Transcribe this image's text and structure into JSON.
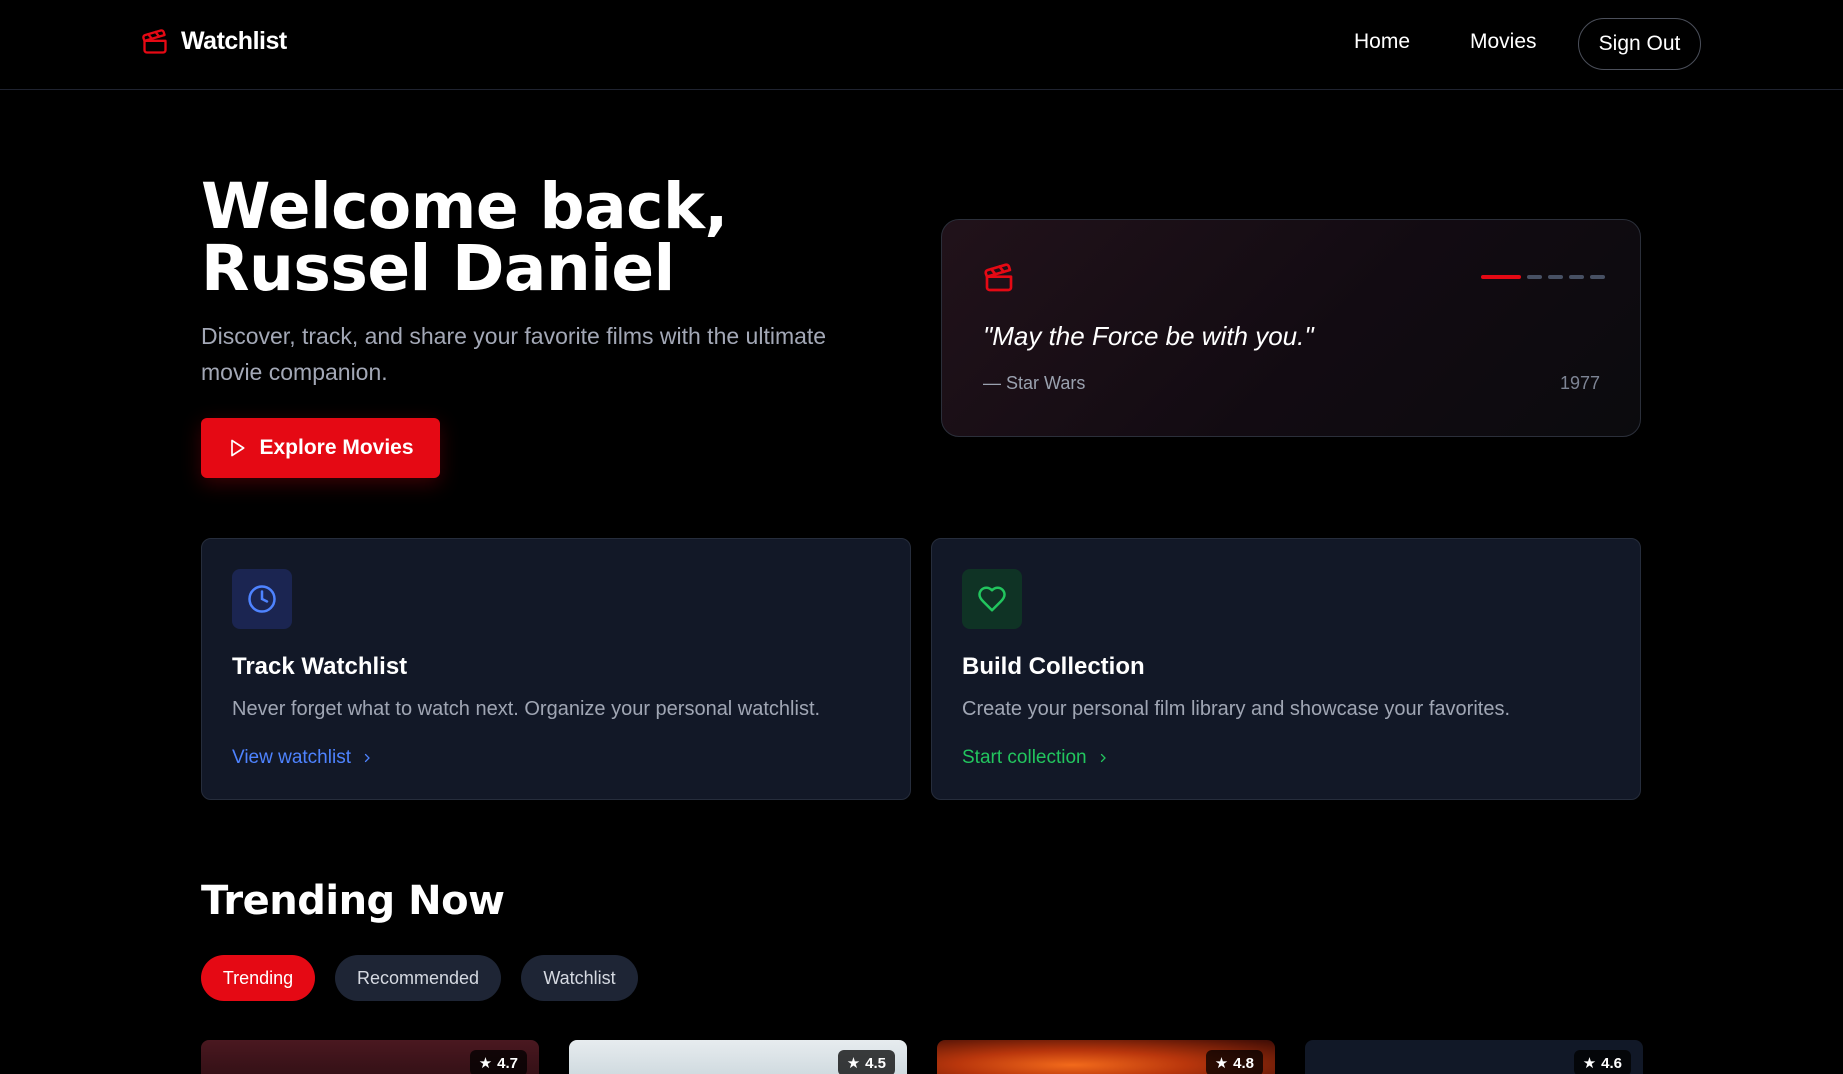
{
  "nav": {
    "brand": "Watchlist",
    "links": [
      "Home",
      "Movies"
    ],
    "sign_out": "Sign Out"
  },
  "hero": {
    "title_line1": "Welcome back,",
    "title_line2": "Russel Daniel",
    "subtitle": "Discover, track, and share your favorite films with the ultimate movie companion.",
    "cta": "Explore Movies"
  },
  "quote": {
    "text": "\"May the Force be with you.\"",
    "film": "— Star Wars",
    "year": "1977",
    "active_index": 0,
    "count": 5
  },
  "features": [
    {
      "title": "Track Watchlist",
      "description": "Never forget what to watch next. Organize your personal watchlist.",
      "link": "View watchlist",
      "icon": "clock-icon",
      "accent": "#4e83ff"
    },
    {
      "title": "Build Collection",
      "description": "Create your personal film library and showcase your favorites.",
      "link": "Start collection",
      "icon": "heart-icon",
      "accent": "#22c55e"
    }
  ],
  "trending": {
    "title": "Trending Now",
    "tabs": [
      "Trending",
      "Recommended",
      "Watchlist"
    ],
    "active_tab": "Trending",
    "movies": [
      {
        "rating": "4.7"
      },
      {
        "rating": "4.5"
      },
      {
        "rating": "4.8"
      },
      {
        "rating": "4.6"
      }
    ]
  },
  "colors": {
    "accent": "#e50914",
    "card_bg": "#121827"
  }
}
